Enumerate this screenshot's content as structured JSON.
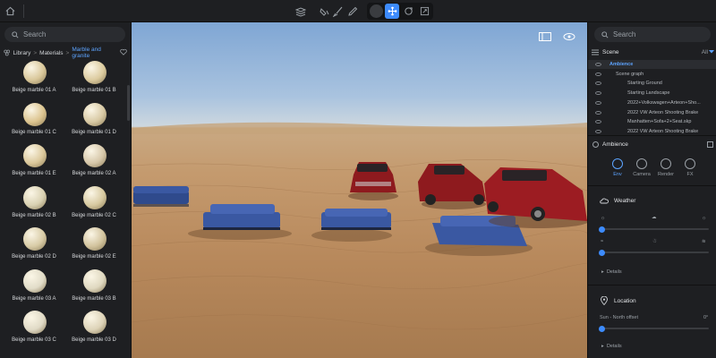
{
  "toolbar": {
    "icons": [
      "home-icon",
      "layers-icon",
      "paint-icon",
      "brush-icon",
      "eyedropper-icon",
      "render-mode-icon",
      "move-icon",
      "rotate-icon",
      "scale-icon"
    ],
    "accent": "#3d8bfd"
  },
  "library": {
    "search_placeholder": "Search",
    "breadcrumb": {
      "root": "Library",
      "sep1": ">",
      "mid": "Materials",
      "sep2": ">",
      "current": "Marble and granite"
    },
    "materials": [
      {
        "name": "Beige marble 01 A",
        "color": "#d9c79a"
      },
      {
        "name": "Beige marble 01 B",
        "color": "#dccb9f"
      },
      {
        "name": "Beige marble 01 C",
        "color": "#dcc48f"
      },
      {
        "name": "Beige marble 01 D",
        "color": "#d8c9a4"
      },
      {
        "name": "Beige marble 01 E",
        "color": "#dbc89b"
      },
      {
        "name": "Beige marble 02 A",
        "color": "#d6c7a9"
      },
      {
        "name": "Beige marble 02 B",
        "color": "#d9d1b2"
      },
      {
        "name": "Beige marble 02 C",
        "color": "#d7c9a0"
      },
      {
        "name": "Beige marble 02 D",
        "color": "#d8cba6"
      },
      {
        "name": "Beige marble 02 E",
        "color": "#d2c39d"
      },
      {
        "name": "Beige marble 03 A",
        "color": "#e1dcc8"
      },
      {
        "name": "Beige marble 03 B",
        "color": "#dfd8c0"
      },
      {
        "name": "Beige marble 03 C",
        "color": "#e0dac6"
      },
      {
        "name": "Beige marble 03 D",
        "color": "#ddd3b8"
      }
    ]
  },
  "scene": {
    "search_placeholder": "Search",
    "title": "Scene",
    "filter": "All",
    "items": [
      {
        "label": "Ambience",
        "indent": 0,
        "selected": true
      },
      {
        "label": "Scene graph",
        "indent": 1,
        "selected": false
      },
      {
        "label": "Starting Ground",
        "indent": 2,
        "selected": false
      },
      {
        "label": "Starting Landscape",
        "indent": 2,
        "selected": false
      },
      {
        "label": "2022+Volkswagen+Arteon+Sho...",
        "indent": 2,
        "selected": false
      },
      {
        "label": "2022 VW Arteon Shooting Brake",
        "indent": 2,
        "selected": false
      },
      {
        "label": "Manhatten+Sofa+2+Seat.skp",
        "indent": 2,
        "selected": false
      },
      {
        "label": "2022 VW Arteon Shooting Brake",
        "indent": 2,
        "selected": false
      }
    ]
  },
  "ambience": {
    "title": "Ambience",
    "tabs": [
      {
        "label": "Env",
        "active": true
      },
      {
        "label": "Camera",
        "active": false
      },
      {
        "label": "Render",
        "active": false
      },
      {
        "label": "FX",
        "active": false
      }
    ],
    "weather_title": "Weather",
    "details_1": "Details",
    "location_title": "Location",
    "offset_label": "Sun - North offset",
    "offset_value": "0°",
    "details_2": "Details"
  }
}
